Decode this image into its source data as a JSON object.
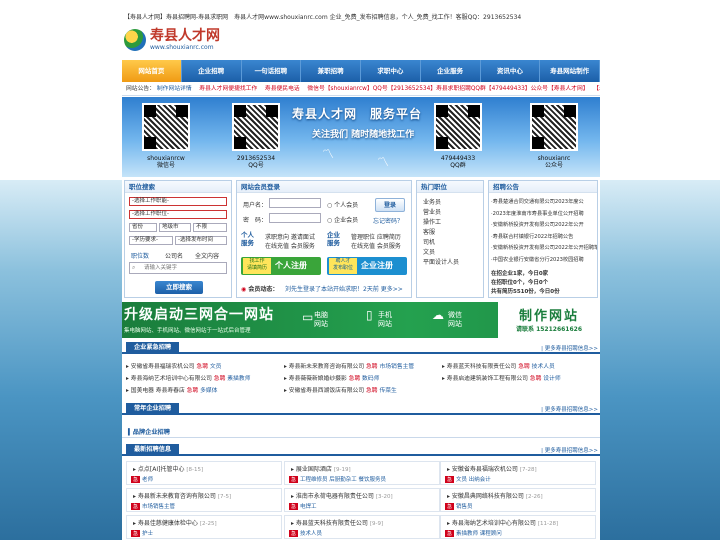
{
  "top": {
    "text": "【寿县人才网】寿县招聘网-寿县求职网　寿县人才网www.shouxianrc.com 企业_免费_发布招聘信息，个人_免费_找工作！客服QQ：2913652534"
  },
  "logo": {
    "title": "寿县人才网",
    "url": "www.shouxianrc.com"
  },
  "nav": [
    "网站首页",
    "企业招聘",
    "一句话招聘",
    "兼职招聘",
    "求职中心",
    "企业服务",
    "资讯中心",
    "寿县网站制作"
  ],
  "ticker": {
    "label": "网站公告：",
    "items": [
      "制作网站详情",
      "寿县人才网便捷找工作",
      "寿县便民电话",
      "微信号【shouxianrcw】QQ号【2913652534】寿县求职招聘QQ群【479449433】公众号【寿县人才网】",
      "【寿"
    ]
  },
  "banner": {
    "title": "寿县人才网　服务平台",
    "subtitle": "关注我们  随时随地找工作",
    "qr": [
      {
        "line1": "shouxianrcw",
        "line2": "微信号"
      },
      {
        "line1": "2913652534",
        "line2": "QQ号"
      },
      {
        "line1": "479449433",
        "line2": "QQ群"
      },
      {
        "line1": "shouxianrc",
        "line2": "公众号"
      }
    ]
  },
  "search": {
    "title": "职位搜索",
    "sel1": "-选择工作职能-",
    "sel2": "-选择工作职位-",
    "sel3a": "省份",
    "sel3b": "地级市",
    "sel3c": "不限",
    "sel4a": "-学历要求-",
    "sel4b": "-选择发布时间",
    "tabs": [
      "职位数",
      "公司名",
      "全文内容"
    ],
    "placeholder": "请输入关键字",
    "button": "立即搜索"
  },
  "login": {
    "title": "网站会员登录",
    "user_label": "用户名：",
    "pass_label": "密　码：",
    "radio1": "个人会员",
    "radio2": "企业会员",
    "login_btn": "登录",
    "forgot": "忘记密码？",
    "svc1_name": "个人\n服务",
    "svc1_a": "求职意向 邀请面试",
    "svc1_b": "在线充值 会员服务",
    "svc2_name": "企业\n服务",
    "svc2_a": "管理职位 应聘简历",
    "svc2_b": "在线充值 会员服务",
    "reg1_small": "找工作\n请填简历",
    "reg1": "个人注册",
    "reg2_small": "聘人才\n发布职位",
    "reg2": "企业注册",
    "news_label": "会员动态：",
    "news": "刘先生登录了本站开始求职！2天前  更多>>"
  },
  "hotjobs": {
    "title": "热门职位",
    "items": [
      "业务员",
      "营业员",
      "操作工",
      "客服",
      "司机",
      "文员",
      "平面设计人员"
    ]
  },
  "notice": {
    "title": "招聘公告",
    "items": [
      "·寿县楚通合同交通有限公司2023年度公",
      "·2023年度淮南市寿县事业单位公开招聘",
      "·安徽新桥投资开发有限公司2022年公开",
      "·寿县联合村镇银行2022年招聘公告",
      "·安徽新桥投资开发有限公司2022年公开招聘笔",
      "·中国农业银行安徽省分行2023校园招聘"
    ],
    "stat1": "在招企业1家，今日0家",
    "stat2": "在招职位0个，今日0个",
    "stat3": "共有简历5510份，今日0份"
  },
  "ad": {
    "headline": "升级启动三网合一网站",
    "sub": "集电脑网站、手机网站、微信网站于一站式后台管理",
    "t1": "电脑\n网站",
    "t2": "手机\n网站",
    "t3": "微信\n网站",
    "brand": "制作网站",
    "phone": "请联系 15212661626"
  },
  "urgent": {
    "title": "企业紧急招聘",
    "more": "| 更多寿县招聘信息>>",
    "rows": [
      [
        {
          "co": "安徽省寿县福瑞农机公司",
          "hot": "急聘",
          "job": "文员"
        },
        {
          "co": "寿县新未来教育咨询有限公司",
          "hot": "急聘",
          "job": "市场销售主管"
        },
        {
          "co": "寿县蓝天科技有限责任公司",
          "hot": "急聘",
          "job": "技术人员"
        }
      ],
      [
        {
          "co": "寿县海纳艺术培训中心有限公司",
          "hot": "急聘",
          "job": "素描教师"
        },
        {
          "co": "寿县薇薇新娘婚纱摄影",
          "hot": "急聘",
          "job": "数码师"
        },
        {
          "co": "寿县启迪建筑装饰工程有限公司",
          "hot": "急聘",
          "job": "设计师"
        }
      ],
      [
        {
          "co": "国美电器 寿县寿春店",
          "hot": "急聘",
          "job": "多媒体"
        },
        {
          "co": "安徽省寿县西湖饭店有限公司",
          "hot": "急聘",
          "job": "传菜生"
        }
      ]
    ]
  },
  "yearly": {
    "title": "常年企业招聘",
    "more": "| 更多寿县招聘信息>>"
  },
  "brand": {
    "title": "品牌企业招聘"
  },
  "latest": {
    "title": "最新招聘信息",
    "more": "| 更多寿县招聘信息>>",
    "cards": [
      {
        "name": "点点[AI]托管中心",
        "date": "[8-15]",
        "tag": "急",
        "job": "老师"
      },
      {
        "name": "展业国际酒店",
        "date": "[9-19]",
        "tag": "急",
        "job": "工程维修员  后厨勤杂工  餐饮服务员"
      },
      {
        "name": "安徽省寿县福瑞农机公司",
        "date": "[7-28]",
        "tag": "急",
        "job": "文员  出纳会计"
      },
      {
        "name": "寿县新未来教育咨询有限公司",
        "date": "[7-5]",
        "tag": "急",
        "job": "市场销售主管"
      },
      {
        "name": "淮南市永荷电器有限责任公司",
        "date": "[3-20]",
        "tag": "急",
        "job": "电焊工"
      },
      {
        "name": "安徽昌典网络科技有限公司",
        "date": "[2-26]",
        "tag": "急",
        "job": "销售员"
      },
      {
        "name": "寿县佳慈健康体检中心",
        "date": "[2-25]",
        "tag": "急",
        "job": "护士"
      },
      {
        "name": "寿县蓝天科技有限责任公司",
        "date": "[9-9]",
        "tag": "急",
        "job": "技术人员"
      },
      {
        "name": "寿县海纳艺术培训中心有限公司",
        "date": "[11-28]",
        "tag": "急",
        "job": "素描教师  课程顾问"
      }
    ]
  }
}
